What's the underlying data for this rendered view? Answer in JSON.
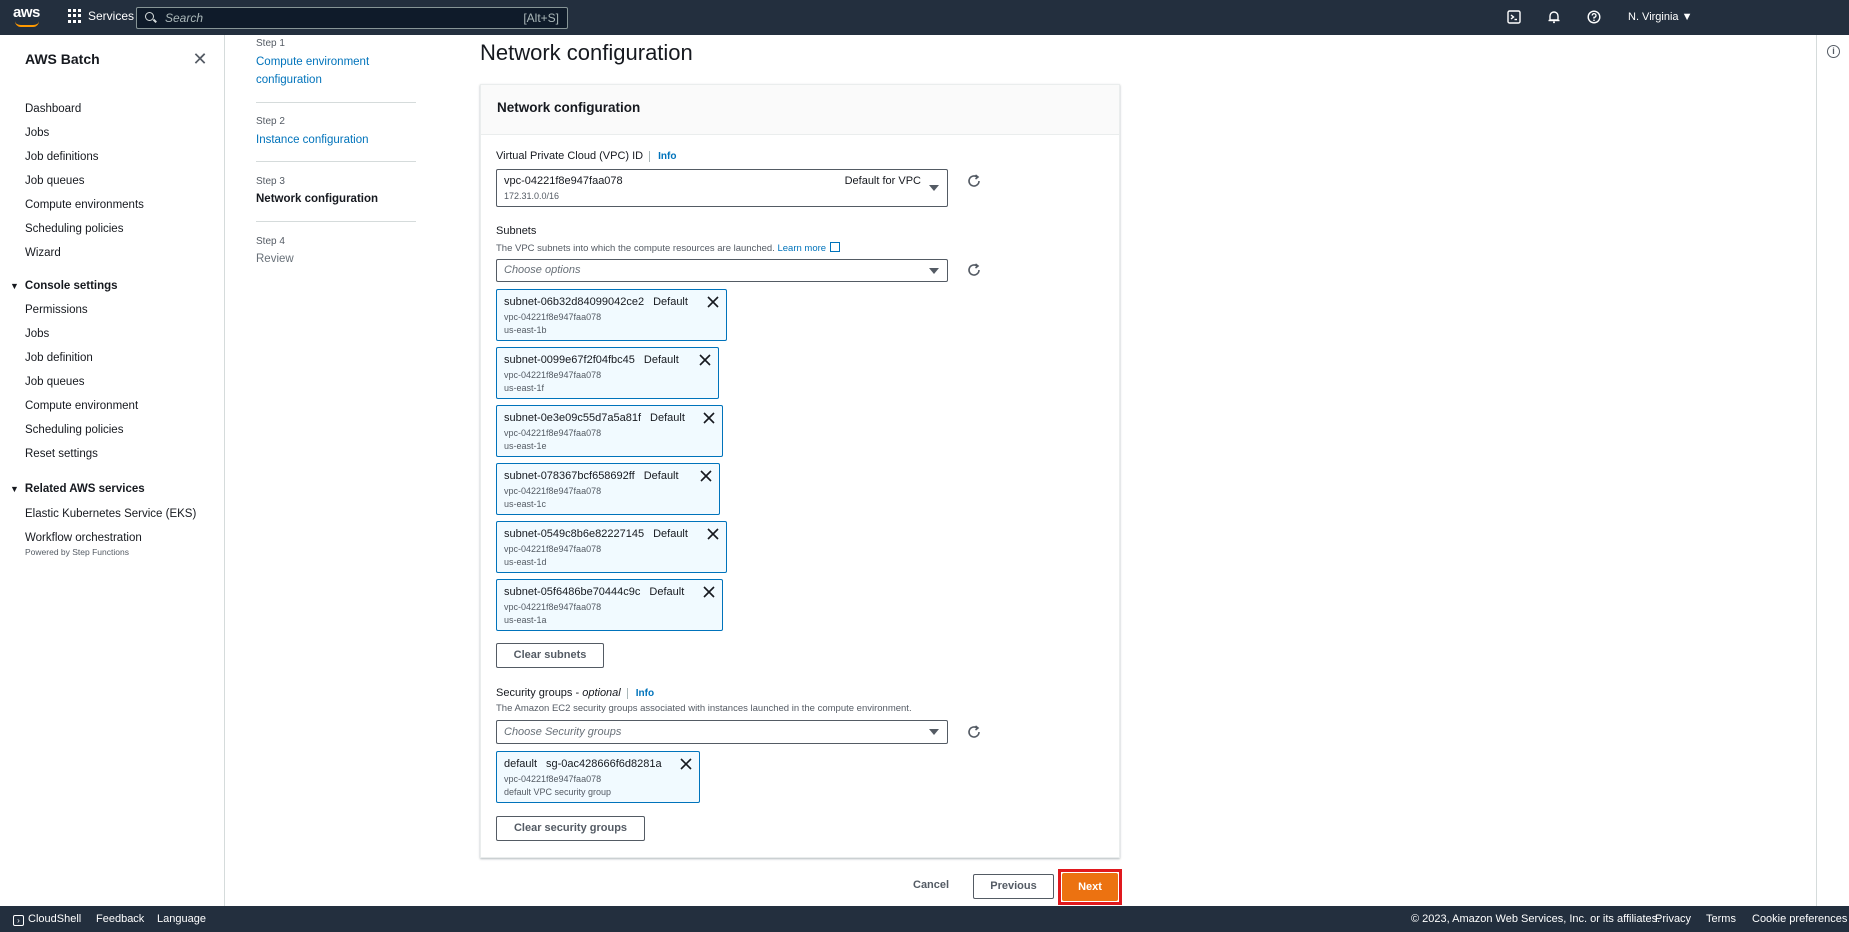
{
  "topnav": {
    "logo": "aws",
    "services_label": "Services",
    "search_placeholder": "Search",
    "search_shortcut": "[Alt+S]",
    "region": "N. Virginia ▼"
  },
  "sidebar": {
    "title": "AWS Batch",
    "items": [
      "Dashboard",
      "Jobs",
      "Job definitions",
      "Job queues",
      "Compute environments",
      "Scheduling policies",
      "Wizard"
    ],
    "console_settings": {
      "title": "Console settings",
      "items": [
        "Permissions",
        "Jobs",
        "Job definition",
        "Job queues",
        "Compute environment",
        "Scheduling policies",
        "Reset settings"
      ]
    },
    "related": {
      "title": "Related AWS services",
      "items": [
        "Elastic Kubernetes Service (EKS)",
        "Workflow orchestration"
      ],
      "workflow_sub": "Powered by Step Functions"
    }
  },
  "steps": [
    {
      "label": "Step 1",
      "title": "Compute environment configuration"
    },
    {
      "label": "Step 2",
      "title": "Instance configuration"
    },
    {
      "label": "Step 3",
      "title": "Network configuration"
    },
    {
      "label": "Step 4",
      "title": "Review"
    }
  ],
  "page": {
    "title": "Network configuration",
    "container_title": "Network configuration",
    "vpc": {
      "label": "Virtual Private Cloud (VPC) ID",
      "info": "Info",
      "value": "vpc-04221f8e947faa078",
      "cidr": "172.31.0.0/16",
      "tag": "Default for VPC"
    },
    "subnets": {
      "label": "Subnets",
      "description": "The VPC subnets into which the compute resources are launched.",
      "learn_more": "Learn more",
      "placeholder": "Choose options",
      "tokens": [
        {
          "id": "subnet-06b32d84099042ce2",
          "tag": "Default",
          "vpc": "vpc-04221f8e947faa078",
          "az": "us-east-1b"
        },
        {
          "id": "subnet-0099e67f2f04fbc45",
          "tag": "Default",
          "vpc": "vpc-04221f8e947faa078",
          "az": "us-east-1f"
        },
        {
          "id": "subnet-0e3e09c55d7a5a81f",
          "tag": "Default",
          "vpc": "vpc-04221f8e947faa078",
          "az": "us-east-1e"
        },
        {
          "id": "subnet-078367bcf658692ff",
          "tag": "Default",
          "vpc": "vpc-04221f8e947faa078",
          "az": "us-east-1c"
        },
        {
          "id": "subnet-0549c8b6e82227145",
          "tag": "Default",
          "vpc": "vpc-04221f8e947faa078",
          "az": "us-east-1d"
        },
        {
          "id": "subnet-05f6486be70444c9c",
          "tag": "Default",
          "vpc": "vpc-04221f8e947faa078",
          "az": "us-east-1a"
        }
      ],
      "clear_label": "Clear subnets"
    },
    "security_groups": {
      "label": "Security groups - ",
      "optional": "optional",
      "info": "Info",
      "description": "The Amazon EC2 security groups associated with instances launched in the compute environment.",
      "placeholder": "Choose Security groups",
      "token": {
        "name": "default",
        "id": "sg-0ac428666f6d8281a",
        "vpc": "vpc-04221f8e947faa078",
        "desc": "default VPC security group"
      },
      "clear_label": "Clear security groups"
    },
    "actions": {
      "cancel": "Cancel",
      "previous": "Previous",
      "next": "Next"
    }
  },
  "footer": {
    "cloudshell": "CloudShell",
    "feedback": "Feedback",
    "language": "Language",
    "copyright": "© 2023, Amazon Web Services, Inc. or its affiliates.",
    "privacy": "Privacy",
    "terms": "Terms",
    "cookies": "Cookie preferences"
  },
  "colors": {
    "nav_bg": "#232f3e",
    "link": "#0073bb",
    "primary": "#ec7211",
    "highlight": "#e0191e"
  }
}
